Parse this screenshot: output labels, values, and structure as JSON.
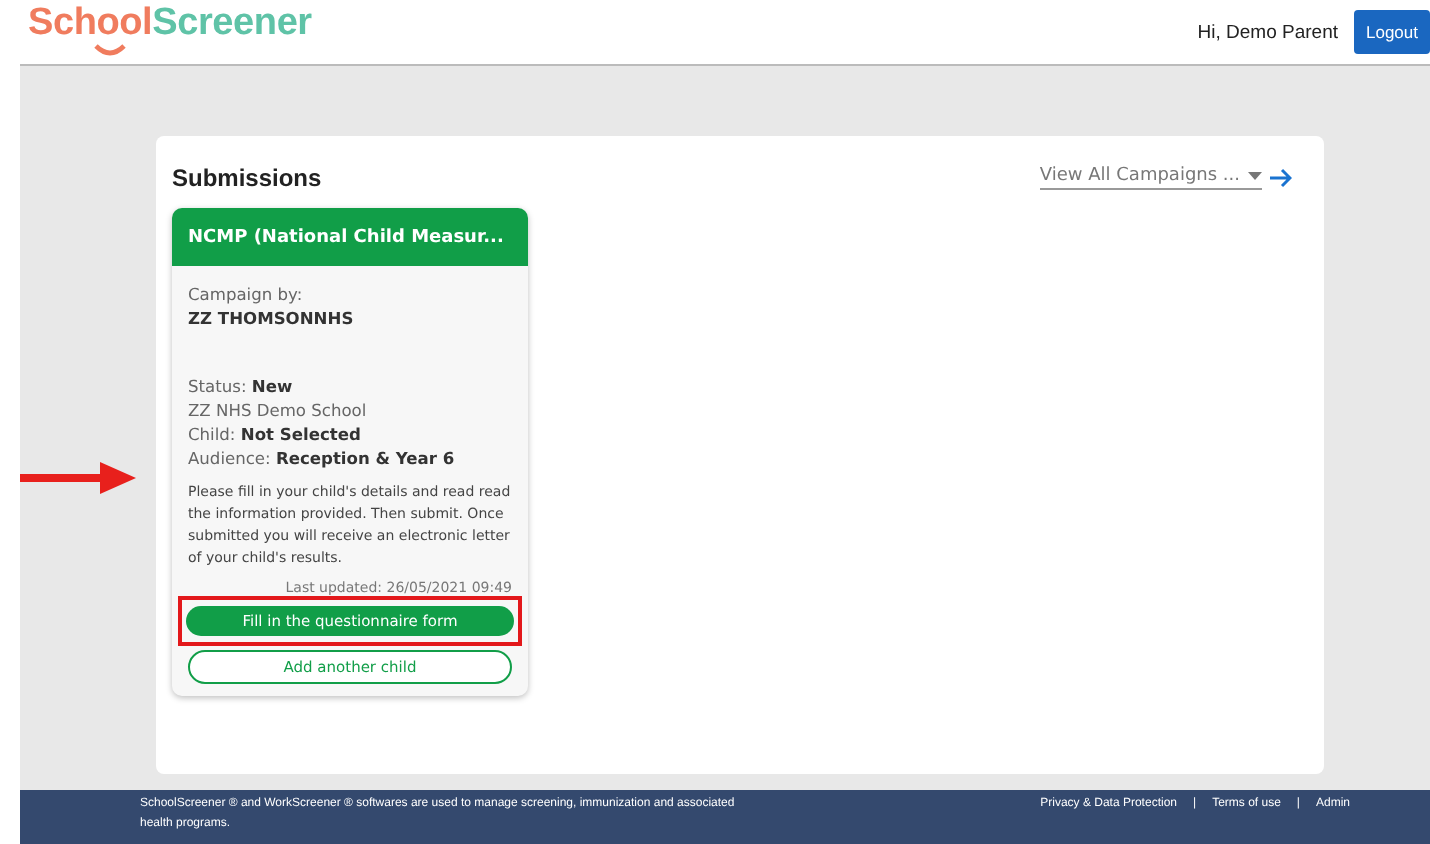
{
  "header": {
    "logo": [
      "School",
      "Screener"
    ],
    "greeting": "Hi, Demo Parent",
    "logout": "Logout"
  },
  "panel": {
    "title": "Submissions",
    "campaign_filter": "View All Campaigns ...",
    "cards": [
      {
        "title": "NCMP (National Child Measur...",
        "campaign_by_label": "Campaign by:",
        "campaign_by": "ZZ THOMSONNHS",
        "details": [
          {
            "label": "Status: ",
            "value": "New"
          },
          {
            "label": "ZZ NHS Demo School"
          },
          {
            "label": "Child: ",
            "value": "Not Selected"
          },
          {
            "label": "Audience: ",
            "value": "Reception & Year 6"
          }
        ],
        "description": "Please fill in your child's details and read read the information provided. Then submit. Once submitted you will receive an electronic letter of your child's results.",
        "last_updated": "Last updated: 26/05/2021 09:49",
        "primary_button": "Fill in the questionnaire form",
        "secondary_button": "Add another child",
        "highlighted": true
      }
    ]
  },
  "footer": {
    "text": "SchoolScreener ® and WorkScreener ® softwares are used to manage screening, immunization and associated health programs.",
    "links": [
      "Privacy & Data Protection",
      "Terms of use",
      "Admin"
    ],
    "separators": [
      "|",
      "|"
    ]
  }
}
